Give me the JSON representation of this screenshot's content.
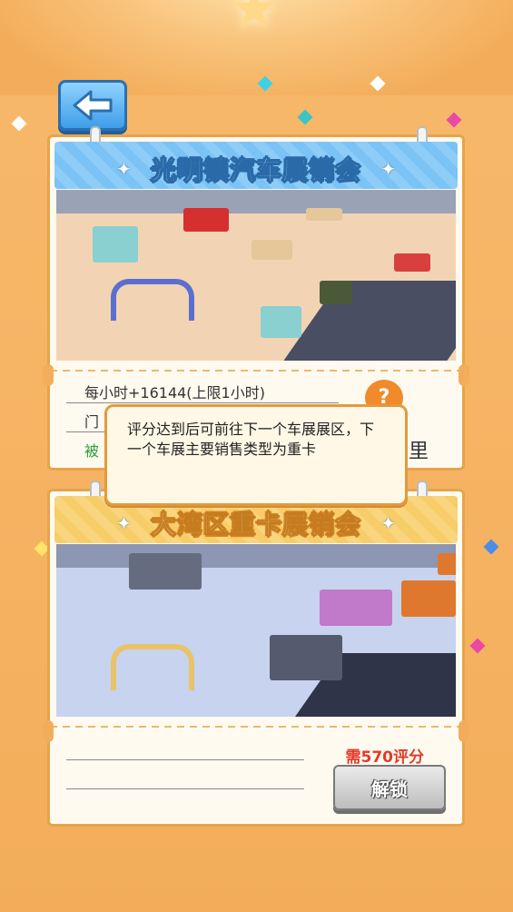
{
  "exhibitions": [
    {
      "title": "光明镇汽车展销会",
      "hourly": "每小时+16144(上限1小时)",
      "ticket_partial": "门",
      "status_partial": "被",
      "trailing_char": "里"
    },
    {
      "title": "大湾区重卡展销会",
      "cost": "需570评分",
      "unlock_label": "解锁"
    }
  ],
  "tooltip": {
    "text": "评分达到后可前往下一个车展展区，下一个车展主要销售类型为重卡"
  },
  "icons": {
    "back": "back-arrow-icon",
    "sparkle": "sparkle-icon"
  },
  "colors": {
    "accent": "#3f9de8",
    "cost": "#e23a2a",
    "status_green": "#2aa03a"
  }
}
